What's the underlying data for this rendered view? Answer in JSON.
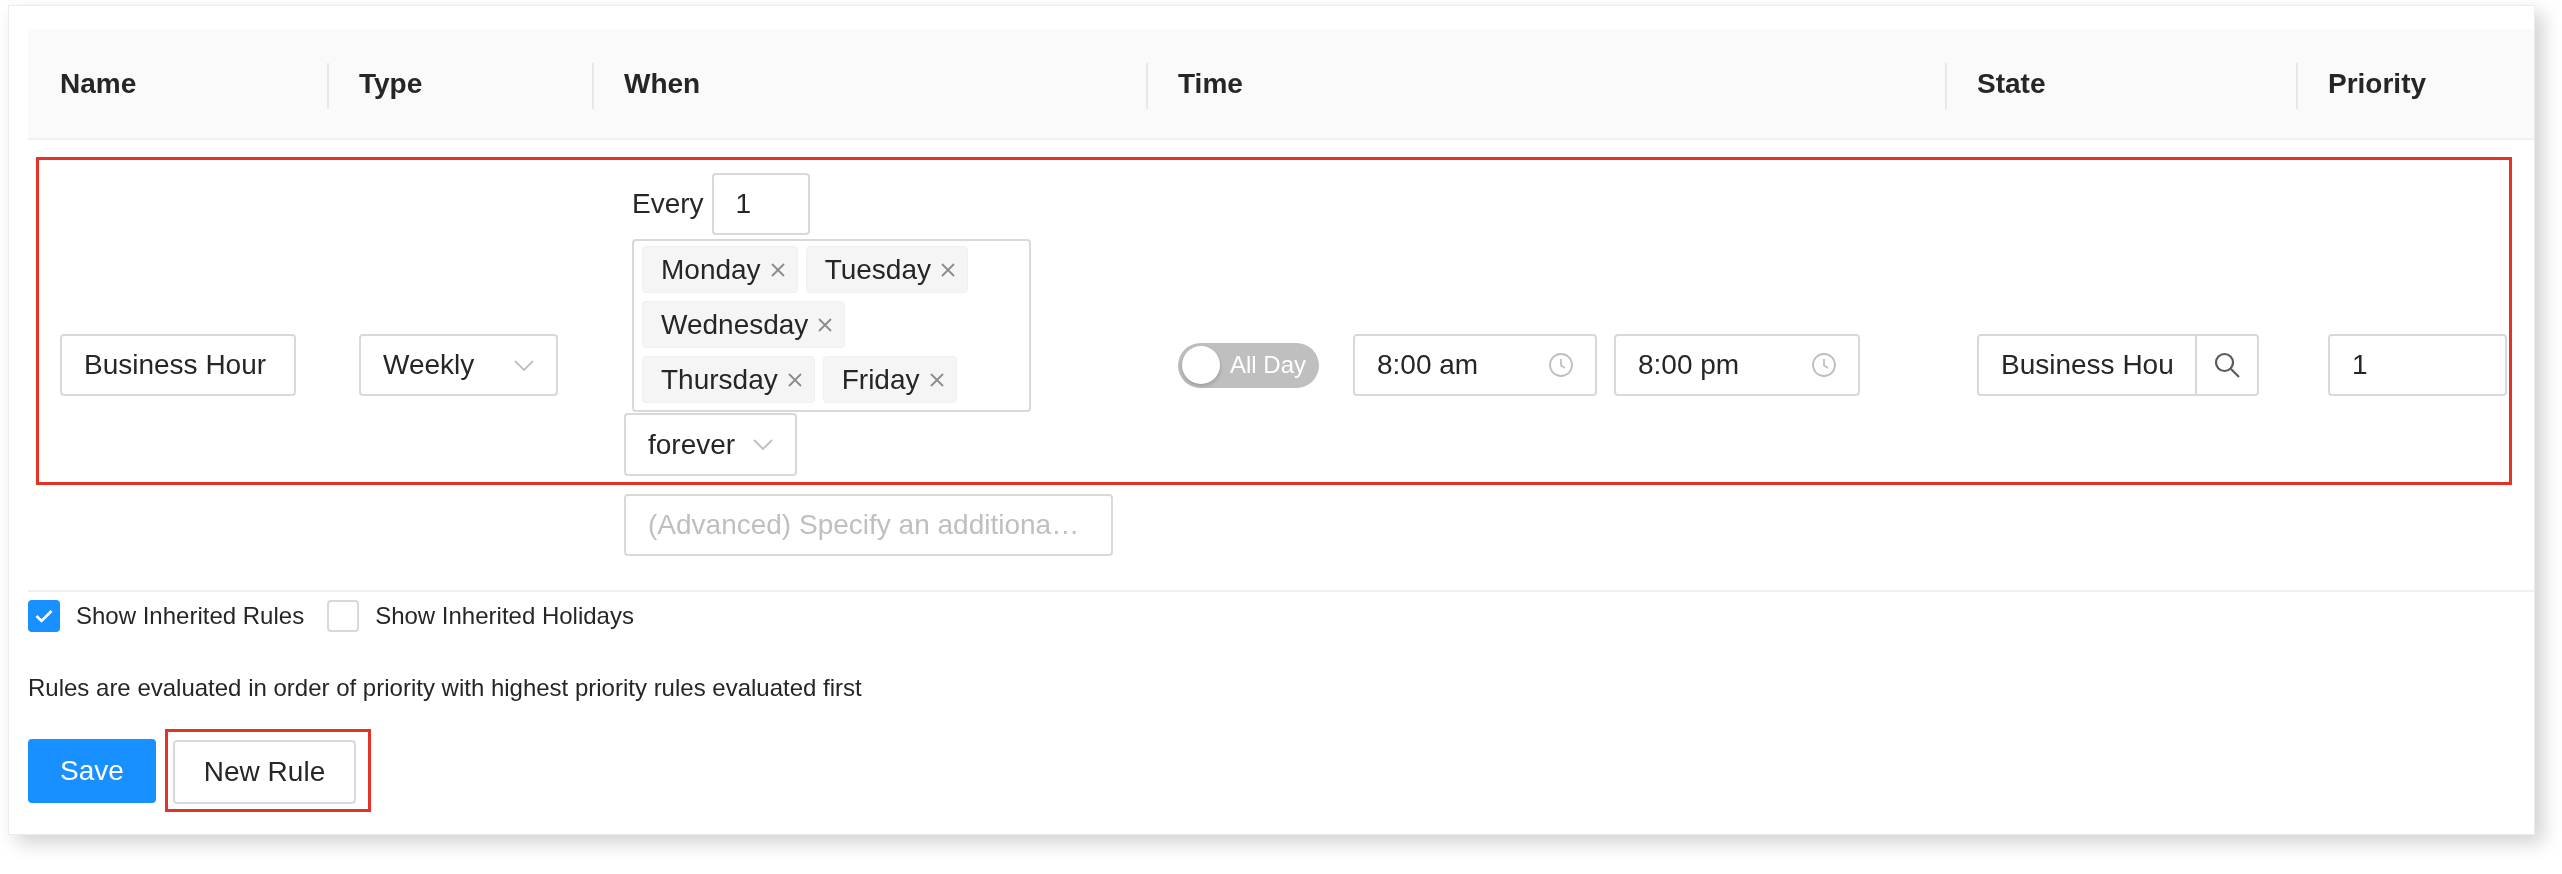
{
  "table": {
    "columns": [
      "Name",
      "Type",
      "When",
      "Time",
      "State",
      "Priority"
    ],
    "rows": [
      {
        "highlighted": true,
        "name": "Business Hour",
        "type": "Weekly",
        "when": {
          "every_label": "Every",
          "every_value": "1",
          "days": [
            "Monday",
            "Tuesday",
            "Wednesday",
            "Thursday",
            "Friday"
          ],
          "duration": "forever",
          "advanced": {
            "placeholder": "(Advanced) Specify an additiona…"
          }
        },
        "time": {
          "all_day": {
            "label": "All Day",
            "on": false
          },
          "start": "8:00 am",
          "end": "8:00 pm"
        },
        "state": "Business Hou",
        "priority": "1"
      }
    ]
  },
  "options": [
    {
      "label": "Show Inherited Rules",
      "checked": true
    },
    {
      "label": "Show Inherited Holidays",
      "checked": false
    }
  ],
  "note": "Rules are evaluated in order of priority with highest priority rules evaluated first",
  "buttons": [
    {
      "label": "Save",
      "kind": "primary",
      "highlighted": false
    },
    {
      "label": "New Rule",
      "kind": "default",
      "highlighted": true
    }
  ]
}
